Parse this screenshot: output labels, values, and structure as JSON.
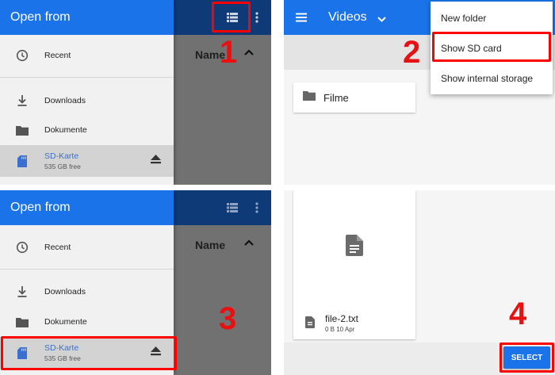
{
  "colors": {
    "accent": "#1a73e8",
    "annotation": "#e81010",
    "scrim": "#717171"
  },
  "drawer": {
    "title": "Open from",
    "items": [
      {
        "icon": "clock-icon",
        "label": "Recent"
      },
      {
        "icon": "download-icon",
        "label": "Downloads"
      },
      {
        "icon": "folder-icon",
        "label": "Dokumente"
      }
    ],
    "sd_card": {
      "icon": "sd-card-icon",
      "label": "SD-Karte",
      "detail": "535 GB free",
      "action_icon": "eject-icon"
    },
    "behind": {
      "sort_label": "Name",
      "grid_icon": "list-view-icon",
      "more_icon": "more-vert-icon"
    }
  },
  "videos": {
    "title": "Videos",
    "folder": "Filme",
    "menu": [
      "New folder",
      "Show SD card",
      "Show internal storage"
    ]
  },
  "files": {
    "file_name": "file-2.txt",
    "file_meta": "0 B 10 Apr",
    "select_label": "SELECT"
  },
  "steps": [
    "1",
    "2",
    "3",
    "4"
  ]
}
